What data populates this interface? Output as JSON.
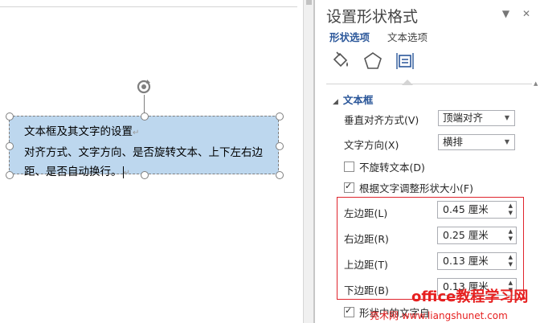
{
  "textbox": {
    "line1": "文本框及其文字的设置",
    "line2": "对齐方式、文字方向、是否旋转文本、上下左右边",
    "line3": "距、是否自动换行。"
  },
  "pane": {
    "title": "设置形状格式",
    "tabs": [
      {
        "label": "形状选项",
        "active": true
      },
      {
        "label": "文本选项",
        "active": false
      }
    ],
    "icons": [
      "fill-line-icon",
      "effects-icon",
      "size-properties-icon"
    ],
    "section": "文本框",
    "vertical_align": {
      "label": "垂直对齐方式(V)",
      "value": "顶端对齐"
    },
    "text_direction": {
      "label": "文字方向(X)",
      "value": "横排"
    },
    "no_rotate": {
      "label": "不旋转文本(D)",
      "checked": false
    },
    "autofit": {
      "label": "根据文字调整形状大小(F)",
      "checked": true
    },
    "left_margin": {
      "label": "左边距(L)",
      "value": "0.45 厘米"
    },
    "right_margin": {
      "label": "右边距(R)",
      "value": "0.25 厘米"
    },
    "top_margin": {
      "label": "上边距(T)",
      "value": "0.13 厘米"
    },
    "bottom_margin": {
      "label": "下边距(B)",
      "value": "0.13 厘米"
    },
    "wrap": {
      "label": "形状中的文字自",
      "checked": true
    }
  },
  "watermark": {
    "line1": "office教程学习网",
    "line2": "亮术网 www.liangshunet.com"
  },
  "colors": {
    "accent": "#2b579a",
    "highlight": "#e0242d",
    "textbox_fill": "#bdd7ee"
  }
}
